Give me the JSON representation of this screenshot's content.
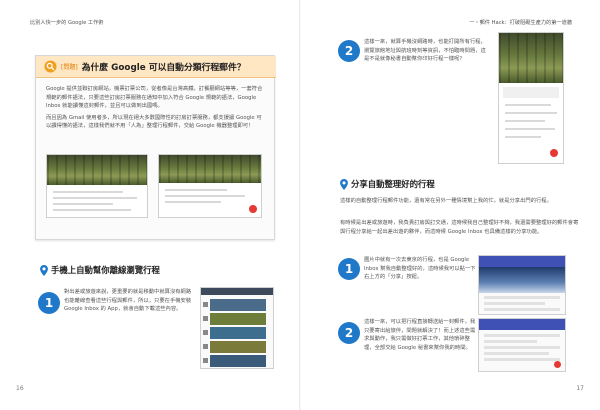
{
  "left_page": {
    "running_head": "比別人快一步的 Google 工作術",
    "page_number": "16",
    "qa_box": {
      "tag": "[問題]",
      "title": "為什麼 Google 可以自動分類行程郵件？",
      "paragraphs": [
        "Google 提供並聯訂房網站，機票訂票公司，從者像是台灣高鐵，訂餐廳網站等等，一套符合規範的郵件語法，只要這些訂房訂票服務在通知中加入符合 Google 規範的語法，Google Inbox 就能讀懂這封郵件，並且可以做到出國嗎。",
        "而且因為 Gmail 使用者多，所以現在絕大多數國際性的訂房訂票服務，都支援讓 Google 可以讀得懂的語法，這樣我們就不用「人為」整理行程郵件，交給 Google 機器整理即可！"
      ]
    },
    "section": {
      "title": "手機上自動幫你離線瀏覽行程",
      "step": {
        "number": "1",
        "text": "對出差或旅遊來說，更重要的就是移動中就算沒有網路也能離線查看這些行程與郵件，所以，只要在手機安裝 Google Inbox 的 App，就會自動下載這些內容。"
      }
    }
  },
  "right_page": {
    "running_head": "一・郵件 Hack：打破阻礙生產力的第一道牆",
    "page_number": "17",
    "top_step": {
      "number": "2",
      "text": "這樣一來，就算手機沒網路時，也能打開所有行程，瀏覽旅館地址與航班時刻等資訊，不怕臨時問題，這是不是就像秘書自動幫你印好行程一樣呢？"
    },
    "section": {
      "title": "分享自動整理好的行程",
      "paragraphs": [
        "這樣的自動整理行程郵件功能，還有常在另外一種情境幫上我的忙，就是分享出門的行程。",
        "有時候是出差或旅遊時，我負責訂房與訂交通，這時候我自己整理好不夠，我還需要整理好的郵件會寄與行程分享給一起出差出遊的夥伴，而這時候 Google Inbox 也具備這樣的分享功能。"
      ],
      "steps": [
        {
          "number": "1",
          "text": "圖片中就有一次去東京的行程，也是 Google Inbox 幫我自動整理好的，這時候我可以點一下右上方的「分享」按鈕。"
        },
        {
          "number": "2",
          "text": "這樣一來，可以把行程直接轉送給一封郵件，我只要寄出給旅伴，問題就解決了！而上述這些需求與動作，我只需做好訂票工作，其他瑣碎整理，全部交給 Google 秘書來幫你我的時間。"
        }
      ]
    }
  },
  "colors": {
    "accent_blue": "#1f78c8",
    "qa_header_bg": "#ffe7c4",
    "qa_tag": "#e07c00",
    "fab_red": "#e53935"
  },
  "icons": [
    "search-icon",
    "location-pin-icon"
  ]
}
